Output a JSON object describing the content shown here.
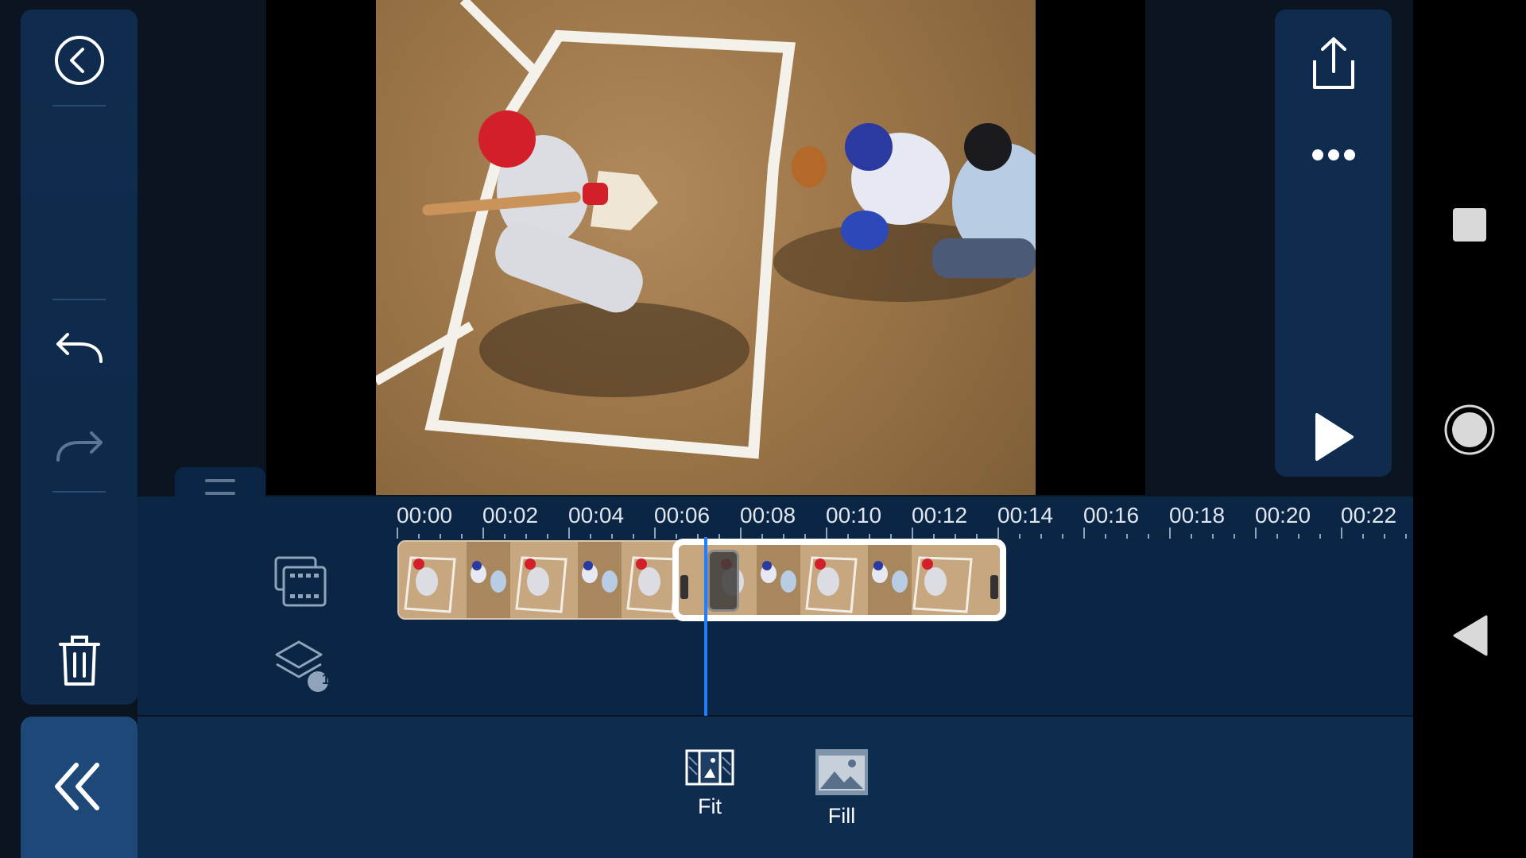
{
  "timeline": {
    "ticks": [
      "00:00",
      "00:02",
      "00:04",
      "00:06",
      "00:08",
      "00:10",
      "00:12",
      "00:14",
      "00:16",
      "00:18",
      "00:20",
      "00:22"
    ]
  },
  "tools": {
    "fit_label": "Fit",
    "fill_label": "Fill"
  },
  "layers": {
    "count": "1"
  },
  "colors": {
    "panel": "#0f2c4e",
    "accent": "#1f7fff",
    "back_panel": "#1d4878"
  },
  "icons": {
    "back": "circle-chevron-left-icon",
    "undo": "undo-icon",
    "redo": "redo-icon",
    "delete": "trash-icon",
    "collapse": "double-chevron-left-icon",
    "export": "share-icon",
    "more": "more-dots-icon",
    "play": "play-icon",
    "media": "media-library-icon",
    "layers": "layers-icon",
    "fit": "fit-icon",
    "fill": "fill-icon",
    "handle": "drag-handle-icon",
    "sys_recents": "square-icon",
    "sys_home": "circle-icon",
    "sys_back": "triangle-back-icon"
  }
}
